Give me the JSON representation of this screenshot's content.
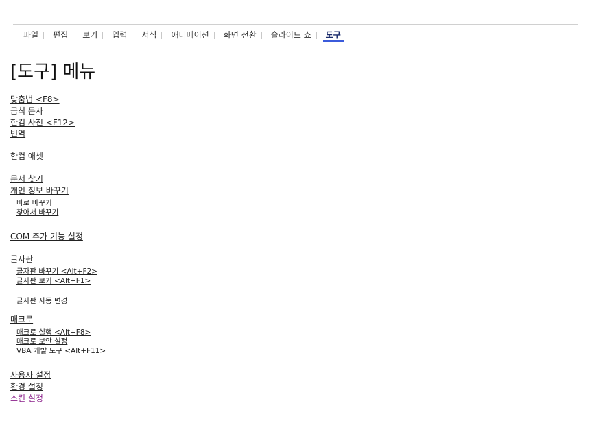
{
  "tabs": [
    {
      "label": "파일"
    },
    {
      "label": "편집"
    },
    {
      "label": "보기"
    },
    {
      "label": "입력"
    },
    {
      "label": "서식"
    },
    {
      "label": "애니메이션"
    },
    {
      "label": "화면 전환"
    },
    {
      "label": "슬라이드 쇼"
    },
    {
      "label": "도구"
    }
  ],
  "active_tab": "도구",
  "page_title": "[도구] 메뉴",
  "links": {
    "spellcheck": "맞춤법 <F8>",
    "forbidden_chars": "금칙 문자",
    "hancom_dictionary": "한컴 사전 <F12>",
    "translate": "번역",
    "hancom_asset": "한컴 애셋",
    "find_document": "문서 찾기",
    "replace_personal_info": "개인 정보 바꾸기",
    "replace_now": "바로 바꾸기",
    "find_and_replace": "찾아서 바꾸기",
    "com_addin_settings": "COM 추가 기능 설정",
    "keyboard": "글자판",
    "change_keyboard": "글자판 바꾸기 <Alt+F2>",
    "view_keyboard": "글자판 보기 <Alt+F1>",
    "auto_change_keyboard": "글자판 자동 변경",
    "macro": "매크로",
    "run_macro": "매크로 실행 <Alt+F8>",
    "macro_security": "매크로 보안 설정",
    "vba_dev_tools": "VBA 개발 도구 <Alt+F11>",
    "user_settings": "사용자 설정",
    "environment_settings": "환경 설정",
    "skin_settings": "스킨 설정"
  },
  "colors": {
    "visited_link": "#8a1f8a",
    "active_tab_underline": "#3b5bdb",
    "active_tab_text": "#1a2b6b"
  }
}
